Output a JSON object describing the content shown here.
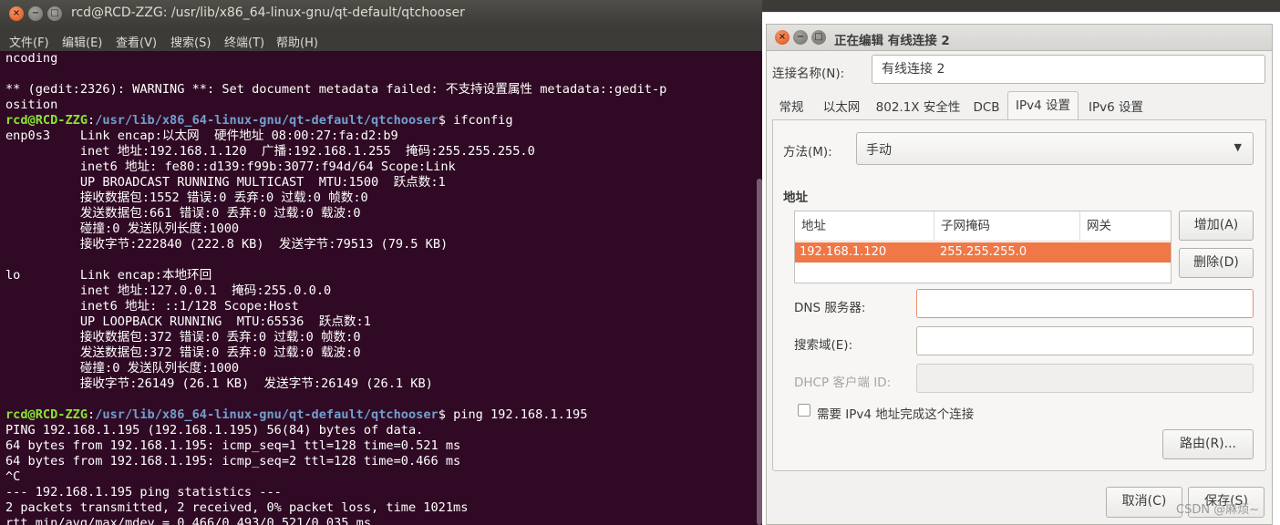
{
  "terminal": {
    "title": "rcd@RCD-ZZG: /usr/lib/x86_64-linux-gnu/qt-default/qtchooser",
    "window_buttons": {
      "close": "×",
      "min": "−",
      "max": "□"
    },
    "menu": [
      "文件(F)",
      "编辑(E)",
      "查看(V)",
      "搜索(S)",
      "终端(T)",
      "帮助(H)"
    ],
    "prompt": {
      "user": "rcd@RCD-ZZG",
      "colon": ":",
      "path": "/usr/lib/x86_64-linux-gnu/qt-default/qtchooser",
      "dollar": "$"
    },
    "lines": [
      "ncoding",
      "",
      "** (gedit:2326): WARNING **: Set document metadata failed: 不支持设置属性 metadata::gedit-p",
      "osition",
      "",
      "enp0s3    Link encap:以太网  硬件地址 08:00:27:fa:d2:b9",
      "          inet 地址:192.168.1.120  广播:192.168.1.255  掩码:255.255.255.0",
      "          inet6 地址: fe80::d139:f99b:3077:f94d/64 Scope:Link",
      "          UP BROADCAST RUNNING MULTICAST  MTU:1500  跃点数:1",
      "          接收数据包:1552 错误:0 丢弃:0 过载:0 帧数:0",
      "          发送数据包:661 错误:0 丢弃:0 过载:0 载波:0",
      "          碰撞:0 发送队列长度:1000",
      "          接收字节:222840 (222.8 KB)  发送字节:79513 (79.5 KB)",
      "",
      "lo        Link encap:本地环回",
      "          inet 地址:127.0.0.1  掩码:255.0.0.0",
      "          inet6 地址: ::1/128 Scope:Host",
      "          UP LOOPBACK RUNNING  MTU:65536  跃点数:1",
      "          接收数据包:372 错误:0 丢弃:0 过载:0 帧数:0",
      "          发送数据包:372 错误:0 丢弃:0 过载:0 载波:0",
      "          碰撞:0 发送队列长度:1000",
      "          接收字节:26149 (26.1 KB)  发送字节:26149 (26.1 KB)",
      "",
      "",
      "PING 192.168.1.195 (192.168.1.195) 56(84) bytes of data.",
      "64 bytes from 192.168.1.195: icmp_seq=1 ttl=128 time=0.521 ms",
      "64 bytes from 192.168.1.195: icmp_seq=2 ttl=128 time=0.466 ms",
      "^C",
      "--- 192.168.1.195 ping statistics ---",
      "2 packets transmitted, 2 received, 0% packet loss, time 1021ms",
      "rtt min/avg/max/mdev = 0.466/0.493/0.521/0.035 ms"
    ],
    "cmd1": " ifconfig",
    "cmd2": " ping 192.168.1.195"
  },
  "dialog": {
    "title": "正在编辑 有线连接 2",
    "window_buttons": {
      "close": "×",
      "min": "−",
      "max": "□"
    },
    "conn_name_label": "连接名称(N):",
    "conn_name_value": "有线连接 2",
    "tabs": [
      "常规",
      "以太网",
      "802.1X 安全性",
      "DCB",
      "IPv4 设置",
      "IPv6 设置"
    ],
    "active_tab": "IPv4 设置",
    "method_label": "方法(M):",
    "method_value": "手动",
    "method_arrow": "▼",
    "address_section": "地址",
    "address_columns": [
      "地址",
      "子网掩码",
      "网关"
    ],
    "address_rows": [
      {
        "address": "192.168.1.120",
        "netmask": "255.255.255.0",
        "gateway": ""
      }
    ],
    "add_button": "增加(A)",
    "delete_button": "删除(D)",
    "dns_label": "DNS 服务器:",
    "dns_value": "",
    "search_label": "搜索域(E):",
    "search_value": "",
    "dhcp_label": "DHCP 客户端 ID:",
    "dhcp_value": "",
    "require_ipv4_label": "需要 IPv4 地址完成这个连接",
    "routes_button": "路由(R)...",
    "cancel_button": "取消(C)",
    "save_button": "保存(S)"
  },
  "watermark": "CSDN @麻烦~"
}
